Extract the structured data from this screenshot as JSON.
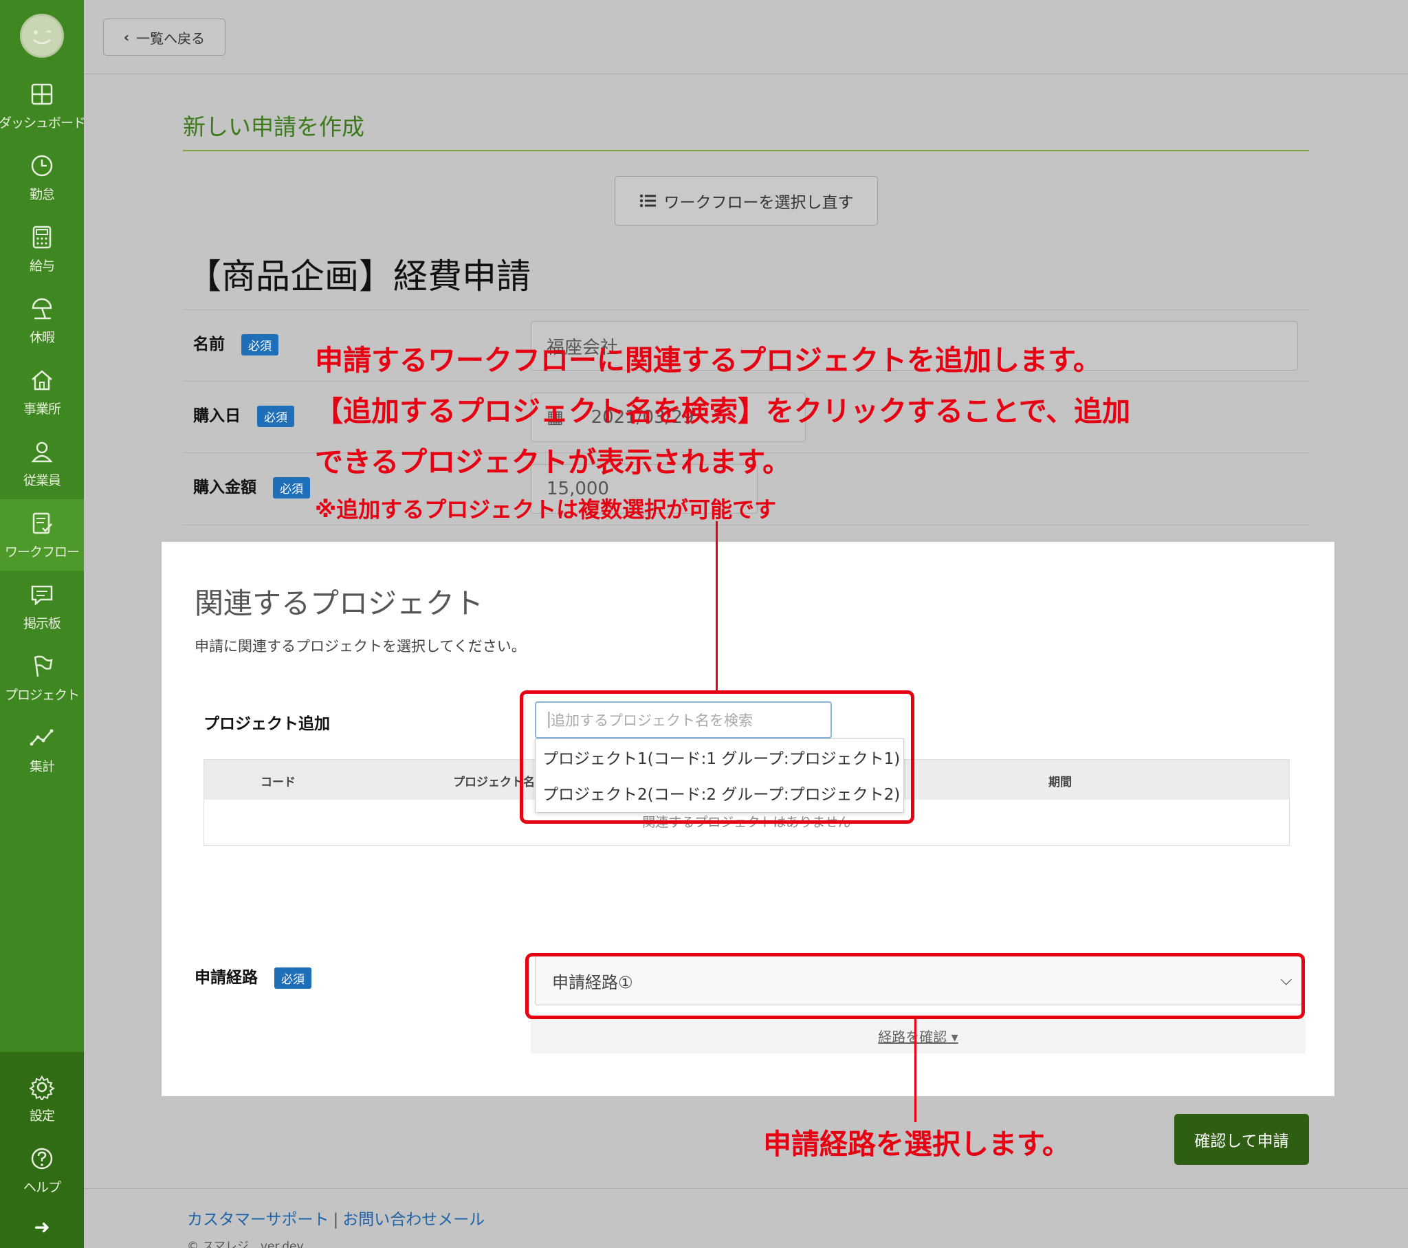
{
  "sidebar": {
    "items": [
      {
        "label": "ダッシュボード",
        "icon": "dashboard-icon"
      },
      {
        "label": "勤怠",
        "icon": "clock-icon"
      },
      {
        "label": "給与",
        "icon": "calculator-icon"
      },
      {
        "label": "休暇",
        "icon": "beach-umbrella-icon"
      },
      {
        "label": "事業所",
        "icon": "home-icon"
      },
      {
        "label": "従業員",
        "icon": "user-icon"
      },
      {
        "label": "ワークフロー",
        "icon": "workflow-icon"
      },
      {
        "label": "掲示板",
        "icon": "message-board-icon"
      },
      {
        "label": "プロジェクト",
        "icon": "flag-icon"
      },
      {
        "label": "集計",
        "icon": "chart-icon"
      }
    ],
    "bottom": [
      {
        "label": "設定",
        "icon": "gear-icon"
      },
      {
        "label": "ヘルプ",
        "icon": "help-icon"
      }
    ],
    "active": "ワークフロー"
  },
  "topbar": {
    "back_label": "一覧へ戻る"
  },
  "page_title": "新しい申請を作成",
  "reselect_label": "ワークフローを選択し直す",
  "form_title": "【商品企画】経費申請",
  "required_badge": "必須",
  "fields": {
    "name": {
      "label": "名前",
      "value": "福座会社"
    },
    "purchase_date": {
      "label": "購入日",
      "value": "2021/03/29"
    },
    "purchase_amount": {
      "label": "購入金額",
      "value": "15,000"
    }
  },
  "project_section": {
    "title": "関連するプロジェクト",
    "description": "申請に関連するプロジェクトを選択してください。",
    "add_label": "プロジェクト追加",
    "search_placeholder": "追加するプロジェクト名を検索",
    "options": [
      "プロジェクト1(コード:1 グループ:プロジェクト1)",
      "プロジェクト2(コード:2 グループ:プロジェクト2)"
    ],
    "table_headers": [
      "コード",
      "プロジェクト名",
      "期間"
    ],
    "empty_message": "関連するプロジェクトはありません"
  },
  "route": {
    "label": "申請経路",
    "selected": "申請経路①",
    "confirm_label": "経路を確認"
  },
  "submit_label": "確認して申請",
  "footer": {
    "support": "カスタマーサポート",
    "separator": "|",
    "contact": "お問い合わせメール",
    "copyright": "© スマレジ　ver.dev"
  },
  "annotations": {
    "line1": "申請するワークフローに関連するプロジェクトを追加します。",
    "line2": "【追加するプロジェクト名を検索】をクリックすることで、追加",
    "line3": "できるプロジェクトが表示されます。",
    "note": "※追加するプロジェクトは複数選択が可能です",
    "route_note": "申請経路を選択します。"
  },
  "colors": {
    "sidebar": "#3f8720",
    "accent_title": "#3d7a1c",
    "required_badge": "#1e6fb7",
    "submit": "#2d5e12",
    "annotation": "#e60012"
  }
}
